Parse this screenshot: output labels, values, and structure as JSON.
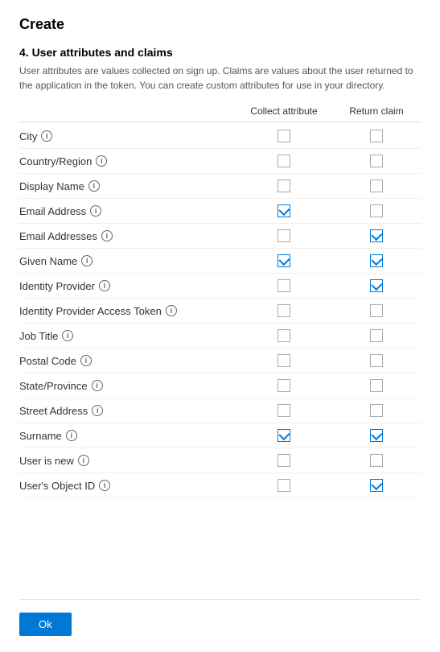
{
  "page": {
    "title": "Create",
    "section_number": "4. User attributes and claims",
    "description": "User attributes are values collected on sign up. Claims are values about the user returned to the application in the token. You can create custom attributes for use in your directory.",
    "col_collect": "Collect attribute",
    "col_return": "Return claim",
    "ok_label": "Ok"
  },
  "attributes": [
    {
      "name": "City",
      "collect": false,
      "return": false
    },
    {
      "name": "Country/Region",
      "collect": false,
      "return": false
    },
    {
      "name": "Display Name",
      "collect": false,
      "return": false
    },
    {
      "name": "Email Address",
      "collect": true,
      "return": false
    },
    {
      "name": "Email Addresses",
      "collect": false,
      "return": true
    },
    {
      "name": "Given Name",
      "collect": true,
      "return": true
    },
    {
      "name": "Identity Provider",
      "collect": false,
      "return": true
    },
    {
      "name": "Identity Provider Access Token",
      "collect": false,
      "return": false
    },
    {
      "name": "Job Title",
      "collect": false,
      "return": false
    },
    {
      "name": "Postal Code",
      "collect": false,
      "return": false
    },
    {
      "name": "State/Province",
      "collect": false,
      "return": false
    },
    {
      "name": "Street Address",
      "collect": false,
      "return": false
    },
    {
      "name": "Surname",
      "collect": true,
      "return": true
    },
    {
      "name": "User is new",
      "collect": false,
      "return": false
    },
    {
      "name": "User's Object ID",
      "collect": false,
      "return": true
    }
  ]
}
